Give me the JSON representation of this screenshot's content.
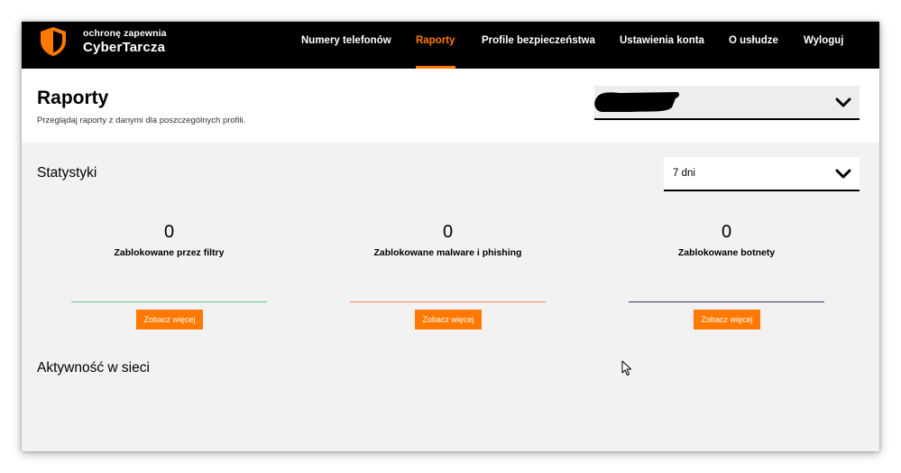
{
  "brand": {
    "sub": "ochronę zapewnia",
    "name": "CyberTarcza"
  },
  "nav": {
    "items": [
      {
        "label": "Numery telefonów"
      },
      {
        "label": "Raporty",
        "active": true
      },
      {
        "label": "Profile bezpieczeństwa"
      },
      {
        "label": "Ustawienia konta"
      },
      {
        "label": "O usłudze"
      },
      {
        "label": "Wyloguj"
      }
    ]
  },
  "header": {
    "title": "Raporty",
    "subtitle": "Przeglądaj raporty z danymi dla poszczególnych profili."
  },
  "profile_select": {
    "value_redacted": true,
    "icon": "chevron-down-icon"
  },
  "stats": {
    "title": "Statystyki",
    "period": "7 dni",
    "cards": [
      {
        "value": "0",
        "label": "Zablokowane przez filtry",
        "line_color": "#5fc98c",
        "button": "Zobacz więcej"
      },
      {
        "value": "0",
        "label": "Zablokowane malware i phishing",
        "line_color": "#f08a5d",
        "button": "Zobacz więcej"
      },
      {
        "value": "0",
        "label": "Zablokowane botnety",
        "line_color": "#2b3a5c",
        "button": "Zobacz więcej"
      }
    ]
  },
  "activity": {
    "title": "Aktywność w sieci"
  },
  "colors": {
    "accent": "#ff7900",
    "topbar": "#000000",
    "background": "#f2f2f2"
  }
}
